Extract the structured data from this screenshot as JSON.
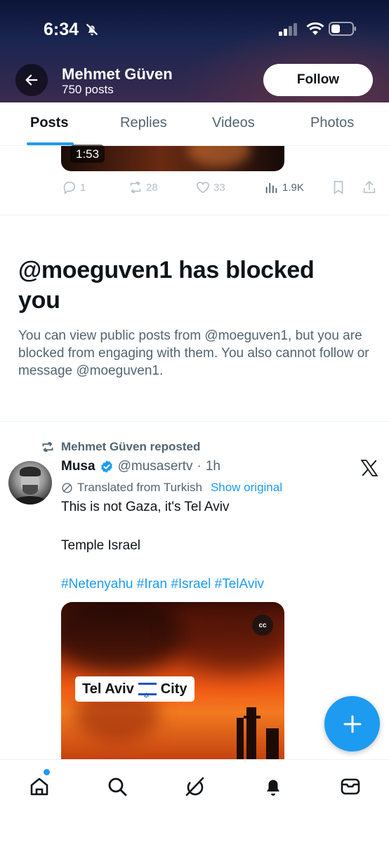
{
  "status_bar": {
    "time": "6:34",
    "icons": [
      "bell-off-icon",
      "signal-icon",
      "wifi-icon",
      "battery-icon"
    ]
  },
  "header": {
    "back_icon": "arrow-left-icon",
    "profile_name": "Mehmet Güven",
    "post_count": "750 posts",
    "follow_label": "Follow"
  },
  "tabs": [
    {
      "label": "Posts",
      "active": true
    },
    {
      "label": "Replies",
      "active": false
    },
    {
      "label": "Videos",
      "active": false
    },
    {
      "label": "Photos",
      "active": false
    }
  ],
  "previous_post": {
    "video_duration": "1:53",
    "actions": {
      "replies": "1",
      "reposts": "28",
      "likes": "33",
      "views": "1.9K"
    }
  },
  "blocked_notice": {
    "title": "@moeguven1 has blocked you",
    "description": "You can view public posts from @moeguven1, but you are blocked from engaging with them. You also cannot follow or message @moeguven1."
  },
  "repost": {
    "repost_label": "Mehmet Güven reposted",
    "author_name": "Musa",
    "handle": "@musasertv",
    "separator": "·",
    "time": "1h",
    "translated_label": "Translated from Turkish",
    "show_original_label": "Show original",
    "text_lines": [
      "This is not Gaza, it's Tel Aviv",
      "Temple Israel"
    ],
    "hashtags": "#Netenyahu #Iran #Israel #TelAviv",
    "media": {
      "cc_label": "cc",
      "overlay_city": "Tel Aviv",
      "overlay_city_suffix": "City"
    }
  },
  "colors": {
    "accent": "#1d9bf0",
    "text_primary": "#0f1419",
    "text_secondary": "#536471"
  },
  "bottom_nav": {
    "items": [
      "home-icon",
      "search-icon",
      "grok-icon",
      "notifications-icon",
      "messages-icon"
    ]
  }
}
